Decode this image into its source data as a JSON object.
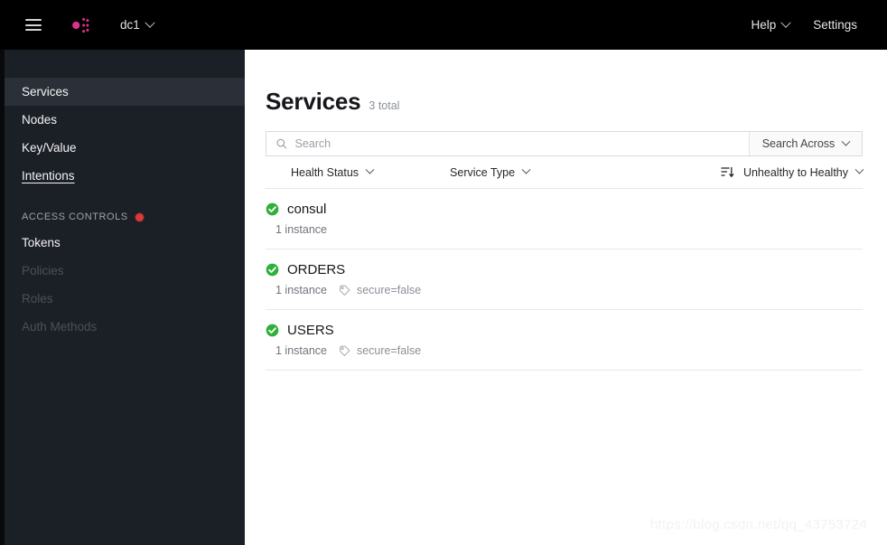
{
  "topbar": {
    "menu_icon": "hamburger-menu-icon",
    "logo_icon": "consul-logo-icon",
    "datacenter": "dc1",
    "help_label": "Help",
    "settings_label": "Settings",
    "background": "#000000"
  },
  "sidebar": {
    "background": "#1b1f26",
    "active_background": "#2a2f38",
    "items": [
      {
        "label": "Services",
        "state": "active"
      },
      {
        "label": "Nodes",
        "state": "default"
      },
      {
        "label": "Key/Value",
        "state": "default"
      },
      {
        "label": "Intentions",
        "state": "hovered"
      }
    ],
    "section": {
      "label": "ACCESS CONTROLS",
      "badge_color": "#d93a3a"
    },
    "acl_items": [
      {
        "label": "Tokens",
        "state": "default"
      },
      {
        "label": "Policies",
        "state": "disabled"
      },
      {
        "label": "Roles",
        "state": "disabled"
      },
      {
        "label": "Auth Methods",
        "state": "disabled"
      }
    ]
  },
  "main": {
    "title": "Services",
    "total": "3 total",
    "search": {
      "placeholder": "Search",
      "value": "",
      "icon": "search-icon",
      "across_label": "Search Across"
    },
    "filters": {
      "health_status": "Health Status",
      "service_type": "Service Type",
      "sort_icon": "sort-descending-icon",
      "sort_label": "Unhealthy to Healthy"
    },
    "services": [
      {
        "name": "consul",
        "health": "passing",
        "instances": "1 instance",
        "tag": ""
      },
      {
        "name": "ORDERS",
        "health": "passing",
        "instances": "1 instance",
        "tag": "secure=false"
      },
      {
        "name": "USERS",
        "health": "passing",
        "instances": "1 instance",
        "tag": "secure=false"
      }
    ]
  },
  "watermark": "https://blog.csdn.net/qq_43753724",
  "colors": {
    "brand_pink": "#e0308f",
    "health_green": "#2eb039",
    "badge_red": "#d93a3a"
  }
}
